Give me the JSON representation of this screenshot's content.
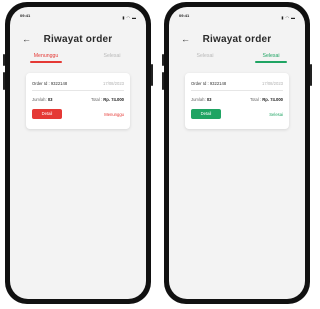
{
  "status_bar": {
    "time": "09:41",
    "icons": [
      "signal-icon",
      "wifi-icon",
      "battery-icon"
    ]
  },
  "screens": [
    {
      "title": "Riwayat order",
      "tabs": [
        {
          "label": "Menunggu",
          "active": true
        },
        {
          "label": "Selesai",
          "active": false
        }
      ],
      "order": {
        "order_id": "Order Id : 9322148",
        "date": "17/08/2023",
        "quantity_label": "Jumlah:",
        "quantity": "03",
        "total_label": "Total :",
        "total": "Rp. 74.000",
        "detail_button": "Detail",
        "status": "Menunggu"
      },
      "accent": "#e53935"
    },
    {
      "title": "Riwayat order",
      "tabs": [
        {
          "label": "Selesai",
          "active": false
        },
        {
          "label": "Selesai",
          "active": true
        }
      ],
      "order": {
        "order_id": "Order Id : 9322148",
        "date": "17/08/2023",
        "quantity_label": "Jumlah:",
        "quantity": "03",
        "total_label": "Total :",
        "total": "Rp. 74.000",
        "detail_button": "Detail",
        "status": "Selesai"
      },
      "accent": "#1fa463"
    }
  ]
}
